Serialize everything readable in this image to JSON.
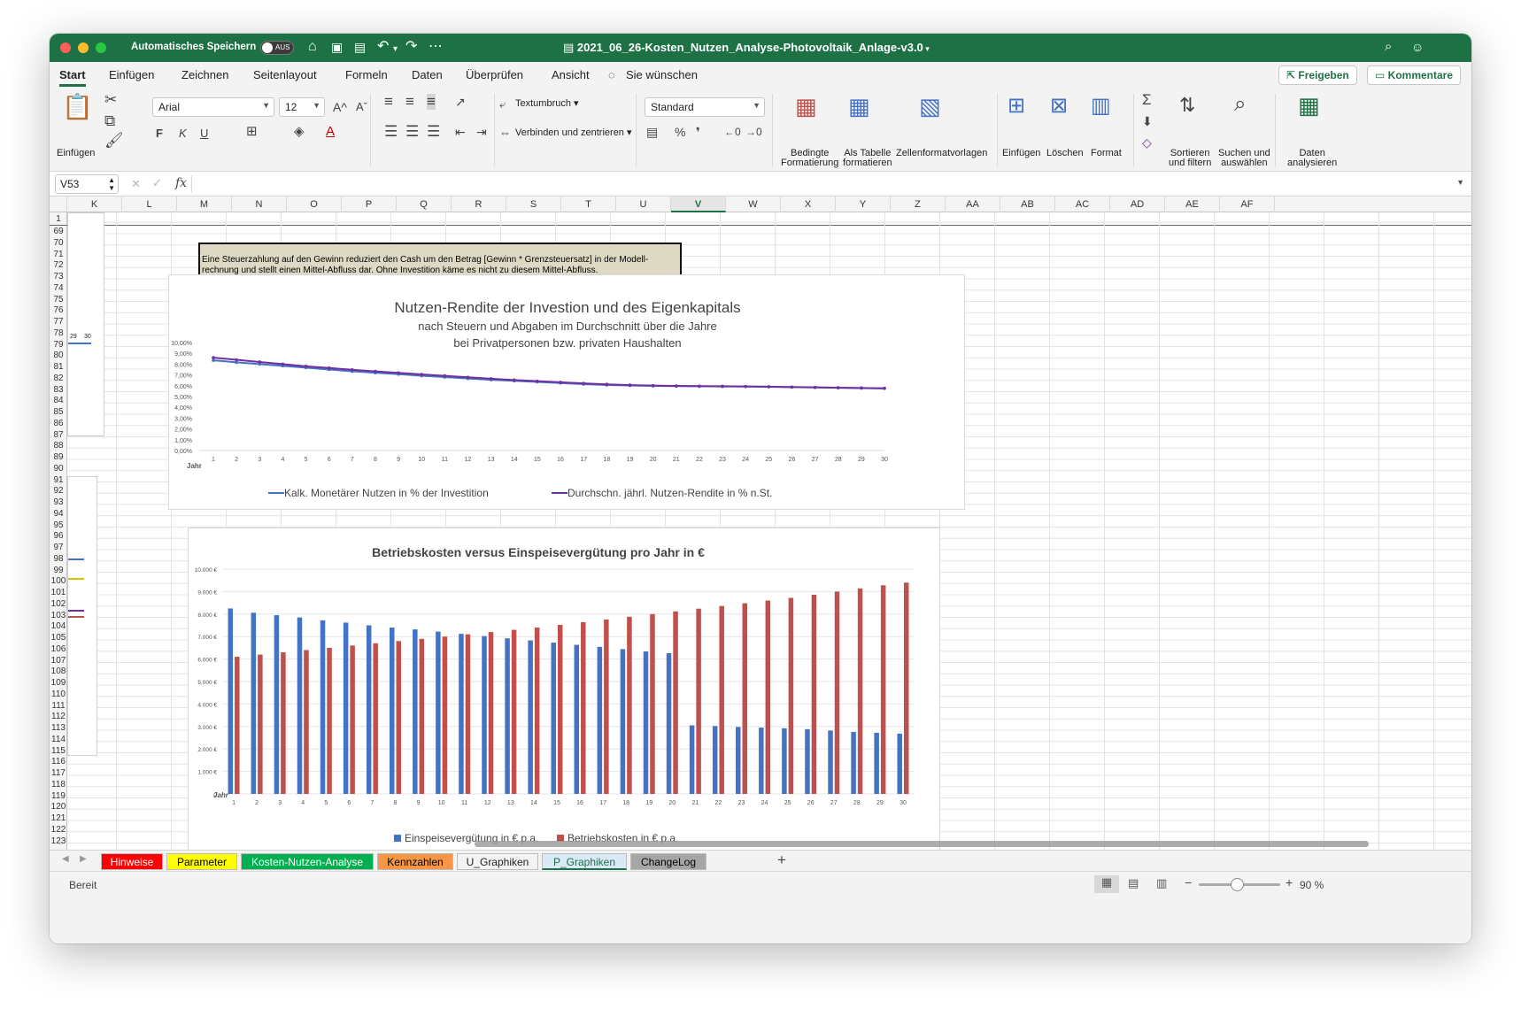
{
  "titlebar": {
    "autosave_label": "Automatisches Speichern",
    "autosave_state": "AUS",
    "document_title": "2021_06_26-Kosten_Nutzen_Analyse-Photovoltaik_Anlage-v3.0"
  },
  "ribbon_tabs": [
    "Start",
    "Einfügen",
    "Zeichnen",
    "Seitenlayout",
    "Formeln",
    "Daten",
    "Überprüfen",
    "Ansicht"
  ],
  "tell_me": "Sie wünschen",
  "share_button": "Freigeben",
  "comments_button": "Kommentare",
  "ribbon": {
    "paste": "Einfügen",
    "font_name": "Arial",
    "font_size": "12",
    "bold": "F",
    "italic": "K",
    "underline": "U",
    "wrap_text": "Textumbruch",
    "merge_center": "Verbinden und zentrieren",
    "number_format": "Standard",
    "percent": "%",
    "thousands": "❜",
    "cond_format": [
      "Bedingte",
      "Formatierung"
    ],
    "as_table": [
      "Als Tabelle",
      "formatieren"
    ],
    "cell_styles": "Zellenformatvorlagen",
    "insert": "Einfügen",
    "delete": "Löschen",
    "format": "Format",
    "sort_filter": [
      "Sortieren",
      "und filtern"
    ],
    "find_select": [
      "Suchen und",
      "auswählen"
    ],
    "analyze": [
      "Daten",
      "analysieren"
    ]
  },
  "formula_bar": {
    "name_box": "V53",
    "fx": "fx",
    "content": ""
  },
  "columns": [
    "K",
    "L",
    "M",
    "N",
    "O",
    "P",
    "Q",
    "R",
    "S",
    "T",
    "U",
    "V",
    "W",
    "X",
    "Y",
    "Z",
    "AA",
    "AB",
    "AC",
    "AD",
    "AE",
    "AF"
  ],
  "selected_column": "V",
  "first_row": "1",
  "rows_start": 69,
  "rows_end": 123,
  "note_text": "Eine Steuerzahlung auf den Gewinn reduziert den Cash um den Betrag [Gewinn * Grenzsteuersatz] in der Modell-rechnung und stellt einen Mittel-Abfluss dar. Ohne Investition käme es nicht zu diesem Mittel-Abfluss.",
  "thumb_labels": [
    "29",
    "30"
  ],
  "chart_data": [
    {
      "type": "line",
      "title": "Nutzen-Rendite der Investion und des Eigenkapitals",
      "subtitle": [
        "nach Steuern und Abgaben im Durchschnitt über die Jahre",
        "bei Privatpersonen bzw. privaten Haushalten"
      ],
      "xlabel": "Jahr",
      "ylim": [
        0,
        10
      ],
      "ytick_labels": [
        "0,00%",
        "1,00%",
        "2,00%",
        "3,00%",
        "4,00%",
        "5,00%",
        "6,00%",
        "7,00%",
        "8,00%",
        "9,00%",
        "10,00%"
      ],
      "x": [
        1,
        2,
        3,
        4,
        5,
        6,
        7,
        8,
        9,
        10,
        11,
        12,
        13,
        14,
        15,
        16,
        17,
        18,
        19,
        20,
        21,
        22,
        23,
        24,
        25,
        26,
        27,
        28,
        29,
        30
      ],
      "series": [
        {
          "name": "Kalk. Monetärer Nutzen in % der Investition",
          "color": "#4472c4",
          "values": [
            8.35,
            8.17,
            8.0,
            7.84,
            7.67,
            7.5,
            7.34,
            7.2,
            7.07,
            6.93,
            6.8,
            6.67,
            6.55,
            6.45,
            6.35,
            6.25,
            6.15,
            6.07,
            6.02,
            5.98,
            5.96,
            5.95,
            5.93,
            5.92,
            5.9,
            5.87,
            5.84,
            5.81,
            5.78,
            5.75
          ]
        },
        {
          "name": "Durchschn. jährl. Nutzen-Rendite in % n.St.",
          "color": "#7030a0",
          "values": [
            8.6,
            8.4,
            8.2,
            8.0,
            7.8,
            7.64,
            7.48,
            7.33,
            7.19,
            7.05,
            6.92,
            6.78,
            6.65,
            6.53,
            6.42,
            6.32,
            6.22,
            6.13,
            6.06,
            6.01,
            5.98,
            5.96,
            5.95,
            5.93,
            5.91,
            5.88,
            5.85,
            5.82,
            5.79,
            5.76
          ]
        }
      ],
      "legend": "bottom",
      "grid": false
    },
    {
      "type": "bar",
      "title": "Betriebskosten versus Einspeisevergütung pro Jahr in €",
      "xlabel": "Jahr",
      "ylim": [
        0,
        10000
      ],
      "ytick_labels": [
        "0",
        "1.000 €",
        "2.000 €",
        "3.000 €",
        "4.000 €",
        "5.000 €",
        "6.000 €",
        "7.000 €",
        "8.000 €",
        "9.000 €",
        "10.000 €"
      ],
      "categories": [
        "1",
        "2",
        "3",
        "4",
        "5",
        "6",
        "7",
        "8",
        "9",
        "10",
        "11",
        "12",
        "13",
        "14",
        "15",
        "16",
        "17",
        "18",
        "19",
        "20",
        "21",
        "22",
        "23",
        "24",
        "25",
        "26",
        "27",
        "28",
        "29",
        "30"
      ],
      "series": [
        {
          "name": "Einspeisevergütung in € p.a.",
          "color": "#4472c4",
          "values": [
            8250,
            8060,
            7950,
            7850,
            7720,
            7620,
            7500,
            7400,
            7320,
            7220,
            7120,
            7020,
            6920,
            6830,
            6730,
            6630,
            6540,
            6440,
            6340,
            6260,
            3050,
            3020,
            2980,
            2950,
            2920,
            2880,
            2820,
            2760,
            2720,
            2680
          ]
        },
        {
          "name": "Betriebskosten in € p.a.",
          "color": "#c0504d",
          "values": [
            6100,
            6200,
            6300,
            6400,
            6500,
            6600,
            6700,
            6800,
            6900,
            7000,
            7100,
            7200,
            7300,
            7400,
            7520,
            7640,
            7760,
            7880,
            8000,
            8120,
            8240,
            8360,
            8480,
            8600,
            8720,
            8860,
            9000,
            9140,
            9280,
            9400
          ]
        }
      ],
      "legend": "bottom",
      "grid": true
    }
  ],
  "sheet_tabs": [
    {
      "label": "Hinweise",
      "bg": "#ff0000",
      "fg": "#ffffff"
    },
    {
      "label": "Parameter",
      "bg": "#ffff00",
      "fg": "#000000"
    },
    {
      "label": "Kosten-Nutzen-Analyse",
      "bg": "#00b050",
      "fg": "#ffffff"
    },
    {
      "label": "Kennzahlen",
      "bg": "#f79646",
      "fg": "#000000"
    },
    {
      "label": "U_Graphiken",
      "bg": "#f3f3f3",
      "fg": "#222222"
    },
    {
      "label": "P_Graphiken",
      "bg": "#dbe9f6",
      "fg": "#1e7145"
    },
    {
      "label": "ChangeLog",
      "bg": "#a6a6a6",
      "fg": "#000000"
    }
  ],
  "add_sheet": "+",
  "status": "Bereit",
  "zoom": "90 %"
}
